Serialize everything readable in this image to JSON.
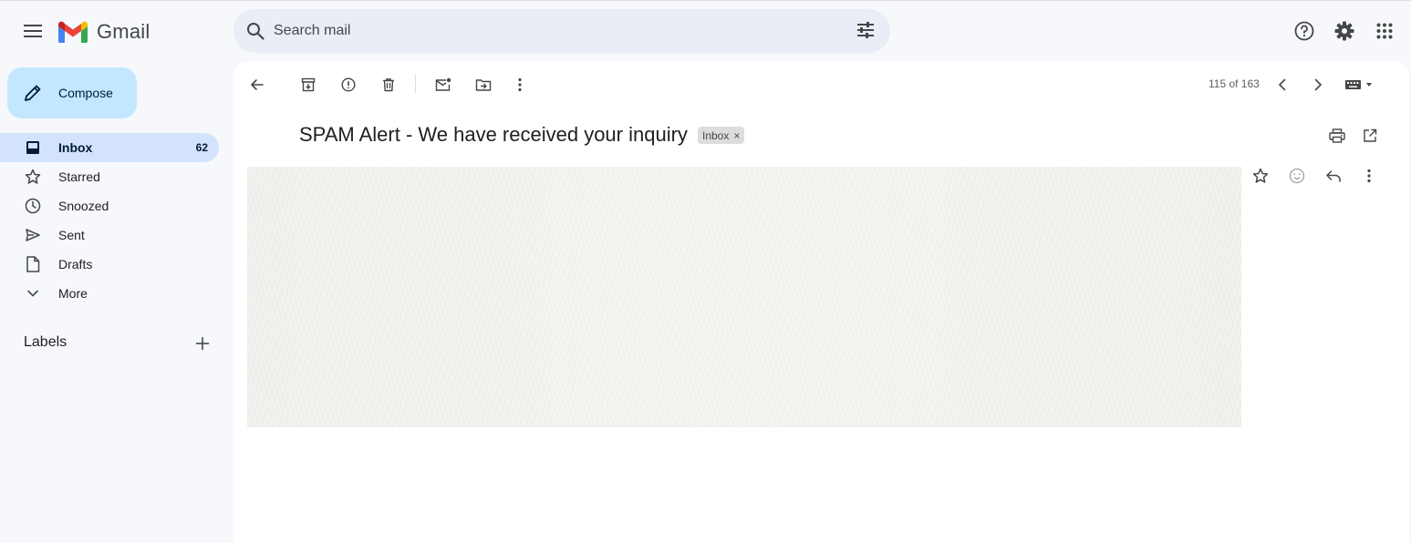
{
  "app": {
    "logo_text": "Gmail"
  },
  "search": {
    "placeholder": "Search mail"
  },
  "compose": {
    "label": "Compose"
  },
  "nav": {
    "items": [
      {
        "label": "Inbox",
        "count": "62",
        "icon": "inbox-icon",
        "active": true
      },
      {
        "label": "Starred",
        "count": "",
        "icon": "star-icon"
      },
      {
        "label": "Snoozed",
        "count": "",
        "icon": "clock-icon"
      },
      {
        "label": "Sent",
        "count": "",
        "icon": "send-icon"
      },
      {
        "label": "Drafts",
        "count": "",
        "icon": "draft-icon"
      },
      {
        "label": "More",
        "count": "",
        "icon": "chevron-down-icon"
      }
    ]
  },
  "labels": {
    "header": "Labels"
  },
  "toolbar": {
    "pager": "115 of 163"
  },
  "message": {
    "subject": "SPAM Alert - We have received your inquiry",
    "label_chip": "Inbox",
    "label_chip_remove": "×"
  },
  "colors": {
    "background": "#f6f8fc",
    "compose": "#c2e7ff",
    "active_nav": "#d3e3fd",
    "search": "#e9eef6"
  }
}
